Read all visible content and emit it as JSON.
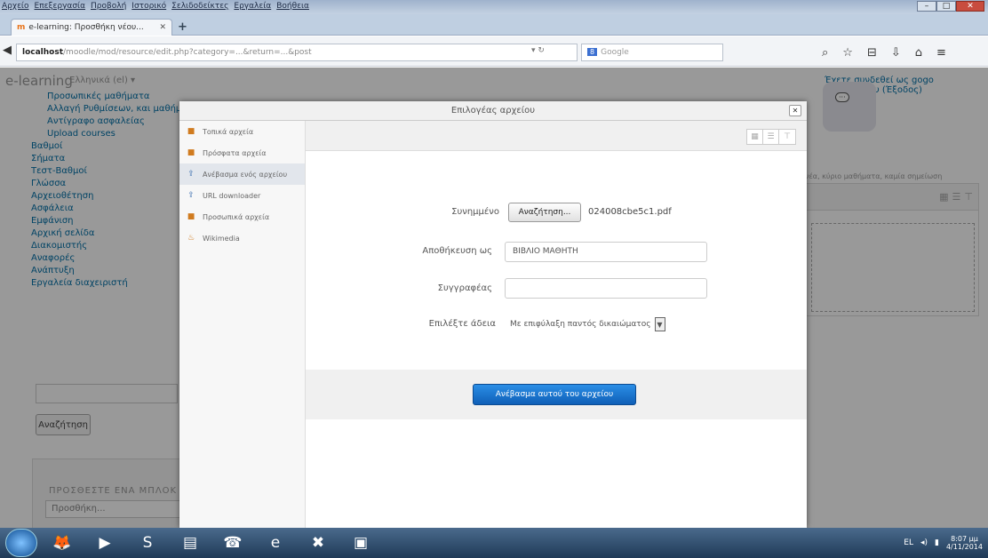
{
  "window": {
    "menus": [
      "Αρχείο",
      "Επεξεργασία",
      "Προβολή",
      "Ιστορικό",
      "Σελιδοδείκτες",
      "Εργαλεία",
      "Βοήθεια"
    ]
  },
  "tab": {
    "title": "e-learning: Προσθήκη νέου..."
  },
  "address": {
    "url_host": "localhost",
    "url_rest": "/moodle/mod/resource/edit.php?category=...&return=...&post",
    "search_placeholder": "Google"
  },
  "page": {
    "brand": "e-learning",
    "language": "Ελληνικά (el) ▾",
    "login_text": "Έχετε συνδεθεί ως gogo παπαρουσου (Έξοδος)",
    "nav_items": [
      "Προσωπικές μαθήματα",
      "Αλλαγή Ρυθμίσεων, και μαθήματος",
      "Αντίγραφο ασφαλείας",
      "Upload courses",
      "Βαθμοί",
      "Σήματα",
      "Τεστ-Βαθμοί",
      "Γλώσσα",
      "Αρχειοθέτηση",
      "Ασφάλεια",
      "Εμφάνιση",
      "Αρχική σελίδα",
      "Διακομιστής",
      "Αναφορές",
      "Ανάπτυξη",
      "Εργαλεία διαχειριστή"
    ],
    "search_button": "Αναζήτηση",
    "add_block_title": "ΠΡΟΣΘΕΣΤΕ ΕΝΑ ΜΠΛΟΚ",
    "add_block_select": "Προσθήκη...",
    "right_text": "νέα, κύριο μαθήματα, καμία σημείωση"
  },
  "dialog": {
    "title": "Επιλογέας αρχείου",
    "repositories": [
      "Τοπικά αρχεία",
      "Πρόσφατα αρχεία",
      "Ανέβασμα ενός αρχείου",
      "URL downloader",
      "Προσωπικά αρχεία",
      "Wikimedia"
    ],
    "selected_repository": "Ανέβασμα ενός αρχείου",
    "fields": {
      "attachment_label": "Συνημμένο",
      "choose_button": "Αναζήτηση...",
      "filename": "024008cbe5c1.pdf",
      "save_as_label": "Αποθήκευση ως",
      "save_as_value": "ΒΙΒΛΙΟ ΜΑΘΗΤΗ",
      "author_label": "Συγγραφέας",
      "author_value": "",
      "license_label": "Επιλέξτε άδεια",
      "license_value": "Με επιφύλαξη παντός δικαιώματος"
    },
    "upload_button": "Ανέβασμα αυτού του αρχείου"
  },
  "taskbar": {
    "lang": "EL",
    "time": "8:07 μμ",
    "date": "4/11/2014"
  }
}
